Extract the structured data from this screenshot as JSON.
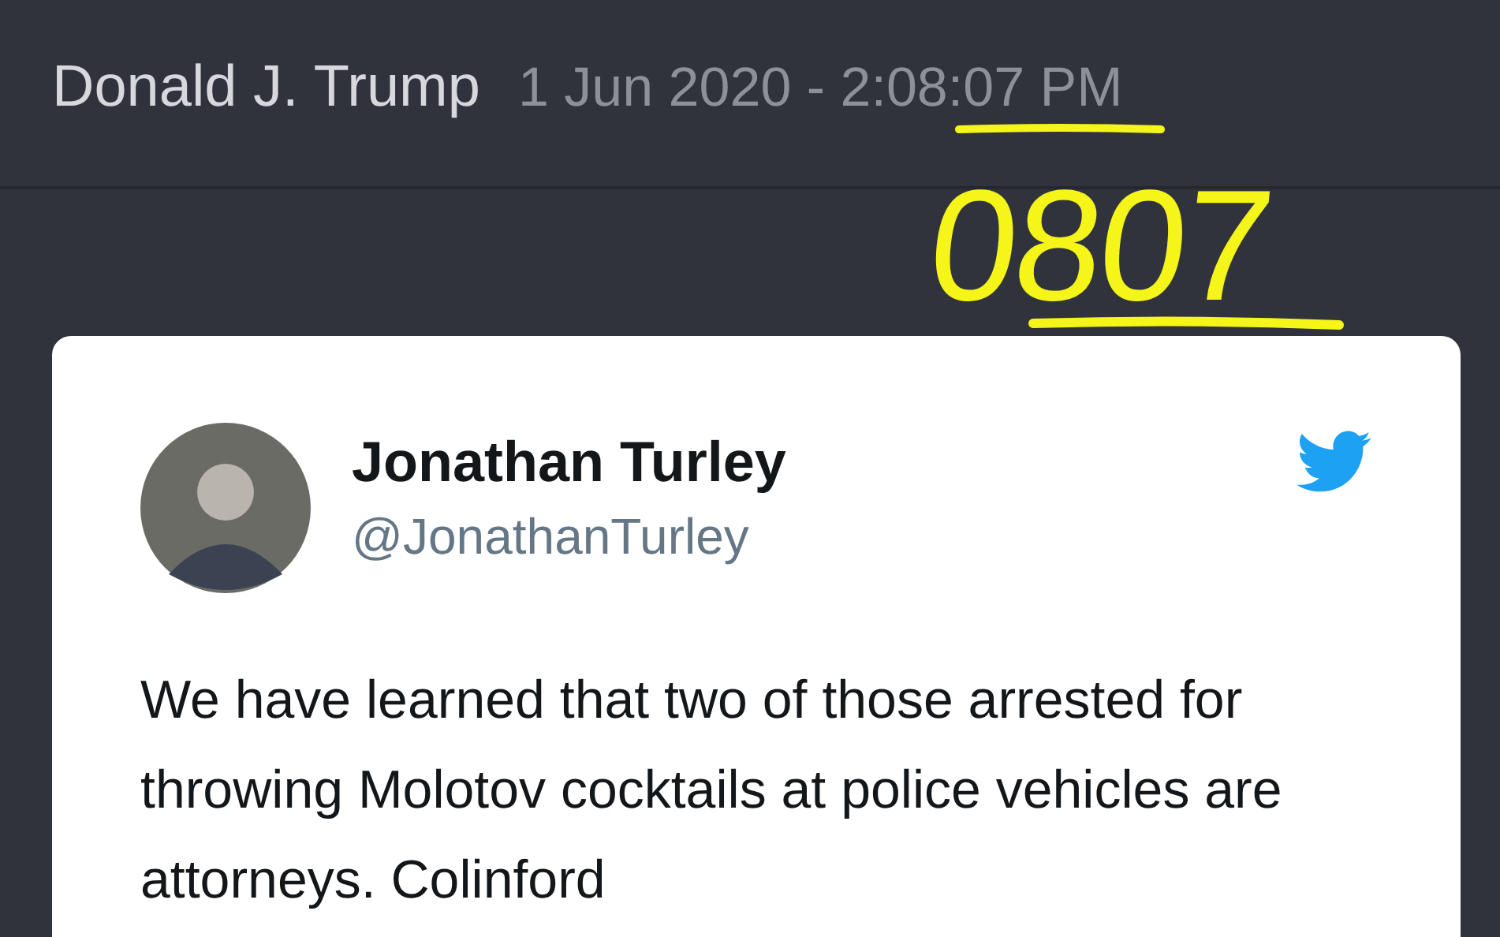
{
  "header": {
    "author": "Donald J. Trump",
    "timestamp": "1 Jun 2020 - 2:08:07 PM"
  },
  "annotation": {
    "text": "0807"
  },
  "tweet": {
    "name": "Jonathan Turley",
    "handle": "@JonathanTurley",
    "text": "We have learned that two of those arrested for throwing Molotov cocktails at police vehicles are attorneys. Colinford"
  }
}
